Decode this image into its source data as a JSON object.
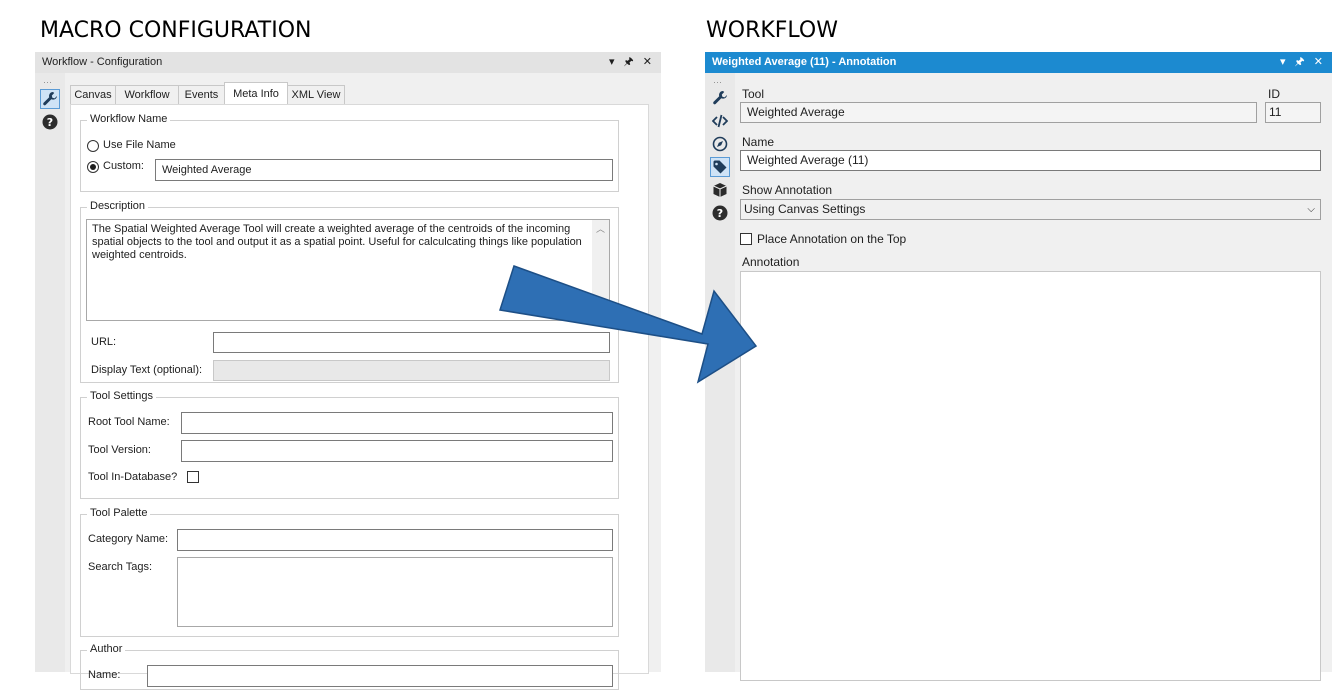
{
  "left_heading": "MACRO CONFIGURATION",
  "right_heading": "WORKFLOW",
  "config": {
    "title": "Workflow - Configuration",
    "title_icons": "▾ 🖈 ✕",
    "tabs": [
      "Canvas",
      "Workflow",
      "Events",
      "Meta Info",
      "XML View"
    ],
    "active_tab": "Meta Info",
    "workflow_name": {
      "legend": "Workflow Name",
      "use_file_name": "Use File Name",
      "custom_label": "Custom:",
      "custom_value": "Weighted Average"
    },
    "description": {
      "legend": "Description",
      "text": "The Spatial Weighted Average Tool will create a weighted average of the centroids of the incoming spatial objects to the tool and output it as a spatial point. Useful for calculcating things like population weighted centroids.",
      "url_label": "URL:",
      "url_value": "",
      "display_text_label": "Display Text (optional):",
      "display_text_value": ""
    },
    "tool_settings": {
      "legend": "Tool Settings",
      "root_tool_name_label": "Root Tool Name:",
      "root_tool_name_value": "",
      "tool_version_label": "Tool Version:",
      "tool_version_value": "",
      "in_database_label": "Tool In-Database?"
    },
    "tool_palette": {
      "legend": "Tool Palette",
      "category_name_label": "Category Name:",
      "category_name_value": "",
      "search_tags_label": "Search Tags:",
      "search_tags_value": ""
    },
    "author": {
      "legend": "Author",
      "name_label": "Name:",
      "name_value": ""
    }
  },
  "annotation": {
    "title": "Weighted Average (11) - Annotation",
    "title_icons": "▾ 🖈 ✕",
    "accent_color": "#1c8ad0",
    "tool_label": "Tool",
    "tool_value": "Weighted Average",
    "id_label": "ID",
    "id_value": "11",
    "name_label": "Name",
    "name_value": "Weighted Average (11)",
    "show_annotation_label": "Show Annotation",
    "show_annotation_value": "Using Canvas Settings",
    "place_on_top_label": "Place Annotation on the Top",
    "annotation_label": "Annotation",
    "annotation_value": ""
  },
  "arrow_color": "#2e6fb4"
}
